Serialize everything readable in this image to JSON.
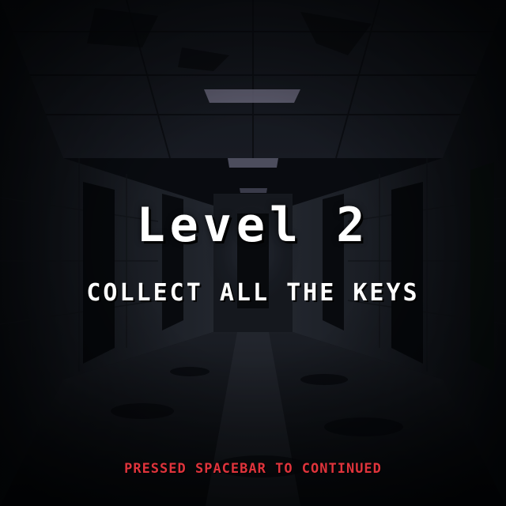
{
  "level": {
    "title": "Level 2",
    "objective": "COLLECT ALL THE KEYS",
    "prompt": "PRESSED SPACEBAR TO CONTINUED"
  },
  "colors": {
    "title_text": "#ffffff",
    "objective_text": "#ffffff",
    "prompt_text": "#e0343c",
    "background": "#0b0d12"
  },
  "background_scene": "dark abandoned hallway"
}
